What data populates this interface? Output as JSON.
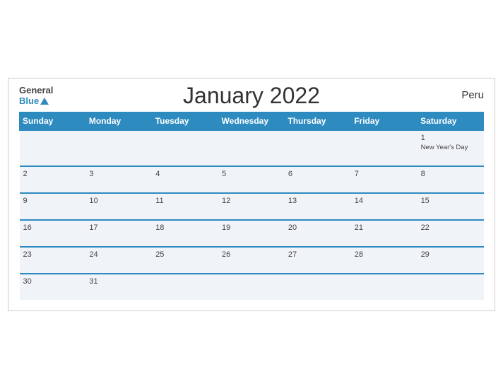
{
  "header": {
    "title": "January 2022",
    "country": "Peru",
    "logo_general": "General",
    "logo_blue": "Blue"
  },
  "days_of_week": [
    "Sunday",
    "Monday",
    "Tuesday",
    "Wednesday",
    "Thursday",
    "Friday",
    "Saturday"
  ],
  "weeks": [
    [
      {
        "num": "",
        "holiday": ""
      },
      {
        "num": "",
        "holiday": ""
      },
      {
        "num": "",
        "holiday": ""
      },
      {
        "num": "",
        "holiday": ""
      },
      {
        "num": "",
        "holiday": ""
      },
      {
        "num": "",
        "holiday": ""
      },
      {
        "num": "1",
        "holiday": "New Year's Day"
      }
    ],
    [
      {
        "num": "2",
        "holiday": ""
      },
      {
        "num": "3",
        "holiday": ""
      },
      {
        "num": "4",
        "holiday": ""
      },
      {
        "num": "5",
        "holiday": ""
      },
      {
        "num": "6",
        "holiday": ""
      },
      {
        "num": "7",
        "holiday": ""
      },
      {
        "num": "8",
        "holiday": ""
      }
    ],
    [
      {
        "num": "9",
        "holiday": ""
      },
      {
        "num": "10",
        "holiday": ""
      },
      {
        "num": "11",
        "holiday": ""
      },
      {
        "num": "12",
        "holiday": ""
      },
      {
        "num": "13",
        "holiday": ""
      },
      {
        "num": "14",
        "holiday": ""
      },
      {
        "num": "15",
        "holiday": ""
      }
    ],
    [
      {
        "num": "16",
        "holiday": ""
      },
      {
        "num": "17",
        "holiday": ""
      },
      {
        "num": "18",
        "holiday": ""
      },
      {
        "num": "19",
        "holiday": ""
      },
      {
        "num": "20",
        "holiday": ""
      },
      {
        "num": "21",
        "holiday": ""
      },
      {
        "num": "22",
        "holiday": ""
      }
    ],
    [
      {
        "num": "23",
        "holiday": ""
      },
      {
        "num": "24",
        "holiday": ""
      },
      {
        "num": "25",
        "holiday": ""
      },
      {
        "num": "26",
        "holiday": ""
      },
      {
        "num": "27",
        "holiday": ""
      },
      {
        "num": "28",
        "holiday": ""
      },
      {
        "num": "29",
        "holiday": ""
      }
    ],
    [
      {
        "num": "30",
        "holiday": ""
      },
      {
        "num": "31",
        "holiday": ""
      },
      {
        "num": "",
        "holiday": ""
      },
      {
        "num": "",
        "holiday": ""
      },
      {
        "num": "",
        "holiday": ""
      },
      {
        "num": "",
        "holiday": ""
      },
      {
        "num": "",
        "holiday": ""
      }
    ]
  ]
}
